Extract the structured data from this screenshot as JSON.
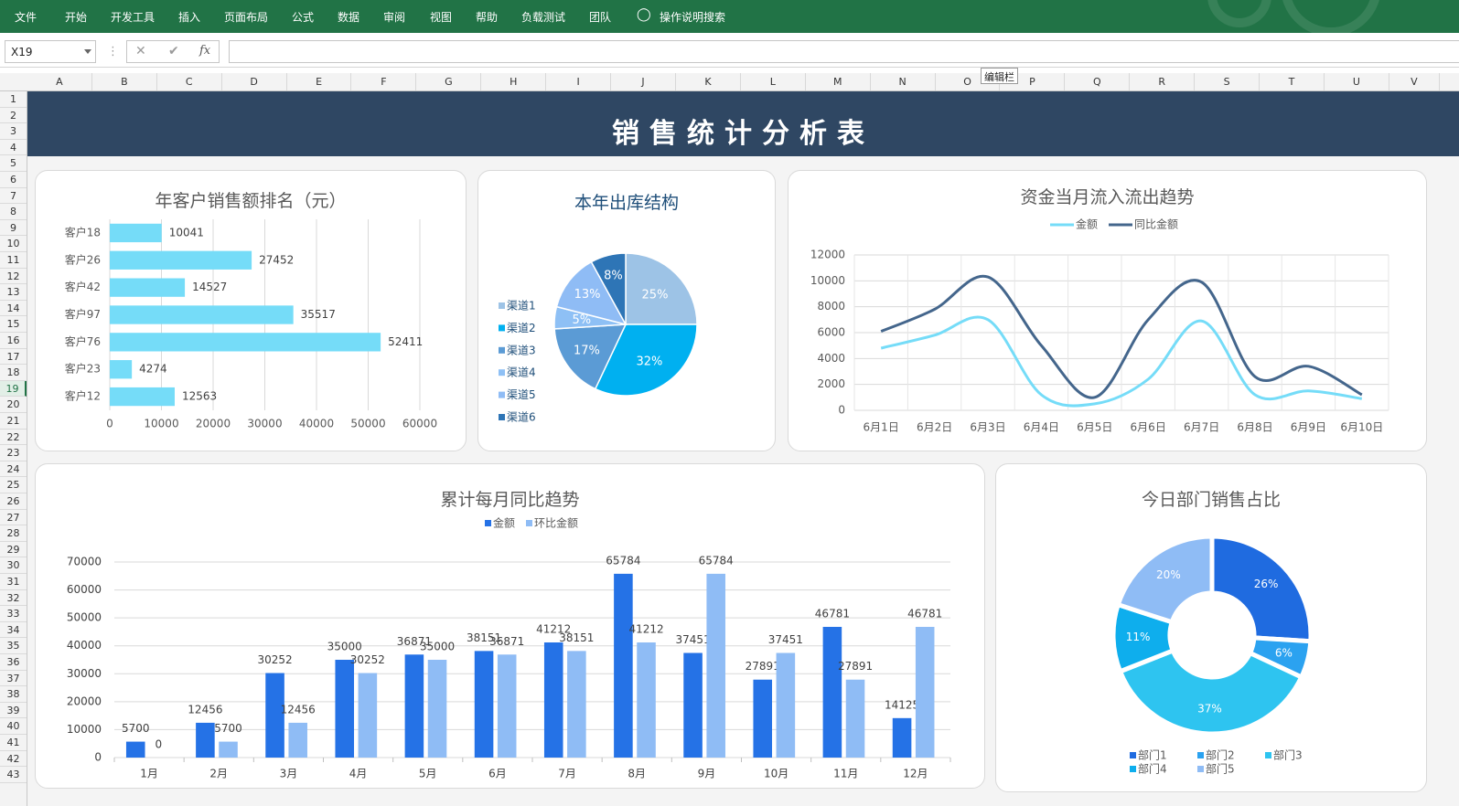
{
  "ribbon": {
    "tabs": [
      "文件",
      "开始",
      "开发工具",
      "插入",
      "页面布局",
      "公式",
      "数据",
      "审阅",
      "视图",
      "帮助",
      "负载测试",
      "团队"
    ],
    "search_label": "操作说明搜索",
    "tab_x": [
      16,
      71,
      121,
      195,
      245,
      319,
      369,
      419,
      470,
      520,
      570,
      644
    ],
    "search_x": 721
  },
  "formula_bar": {
    "name_box": "X19",
    "cancel_icon": "✕",
    "confirm_icon": "✔",
    "fx_label": "fx",
    "formula": "",
    "tooltip": "编辑栏"
  },
  "grid": {
    "columns": [
      "A",
      "B",
      "C",
      "D",
      "E",
      "F",
      "G",
      "H",
      "I",
      "J",
      "K",
      "L",
      "M",
      "N",
      "O",
      "P",
      "Q",
      "R",
      "S",
      "T",
      "U",
      "V"
    ],
    "rows": [
      "1",
      "2",
      "3",
      "4",
      "5",
      "6",
      "7",
      "8",
      "9",
      "10",
      "11",
      "12",
      "13",
      "14",
      "15",
      "16",
      "17",
      "18",
      "19",
      "20",
      "21",
      "22",
      "23",
      "24",
      "25",
      "26",
      "27",
      "28",
      "29",
      "30",
      "31",
      "32",
      "33",
      "34",
      "35",
      "36",
      "37",
      "38",
      "39",
      "40",
      "41",
      "42",
      "43"
    ],
    "selected_row": "19"
  },
  "banner_title": "销售统计分析表",
  "chart_data": [
    {
      "type": "bar",
      "orientation": "horizontal",
      "title": "年客户销售额排名（元）",
      "categories": [
        "客户18",
        "客户26",
        "客户42",
        "客户97",
        "客户76",
        "客户23",
        "客户12"
      ],
      "values": [
        10041,
        27452,
        14527,
        35517,
        52411,
        4274,
        12563
      ],
      "xlim": [
        0,
        60000
      ],
      "xticks": [
        "0",
        "10000",
        "20000",
        "30000",
        "40000",
        "50000",
        "60000"
      ],
      "grid": true,
      "color": "#75dcf8"
    },
    {
      "type": "pie",
      "title": "本年出库结构",
      "legend": [
        "渠道1",
        "渠道2",
        "渠道3",
        "渠道4",
        "渠道5",
        "渠道6"
      ],
      "legend_position": "left",
      "slices": [
        {
          "name": "渠道1",
          "value": 25,
          "label": "25%",
          "color": "#9dc3e6"
        },
        {
          "name": "渠道2",
          "value": 32,
          "label": "32%",
          "color": "#00b0f0"
        },
        {
          "name": "渠道3",
          "value": 17,
          "label": "17%",
          "color": "#5b9bd5"
        },
        {
          "name": "渠道4",
          "value": 5,
          "label": "5%",
          "color": "#8ec0f5"
        },
        {
          "name": "渠道5",
          "value": 13,
          "label": "13%",
          "color": "#8fbcf5"
        },
        {
          "name": "渠道6",
          "value": 8,
          "label": "8%",
          "color": "#2e75b6"
        }
      ]
    },
    {
      "type": "line",
      "title": "资金当月流入流出趋势",
      "categories": [
        "6月1日",
        "6月2日",
        "6月3日",
        "6月4日",
        "6月5日",
        "6月6日",
        "6月7日",
        "6月8日",
        "6月9日",
        "6月10日"
      ],
      "series": [
        {
          "name": "金额",
          "values": [
            4800,
            5800,
            7000,
            1200,
            500,
            2400,
            6900,
            1200,
            1500,
            900
          ],
          "color": "#75dcf8"
        },
        {
          "name": "同比金额",
          "values": [
            6100,
            7800,
            10300,
            5000,
            1000,
            7000,
            9900,
            2600,
            3400,
            1200
          ],
          "color": "#44668c"
        }
      ],
      "ylim": [
        0,
        12000
      ],
      "yticks": [
        "0",
        "2000",
        "4000",
        "6000",
        "8000",
        "10000",
        "12000"
      ],
      "legend_position": "top",
      "grid": true,
      "smooth": true
    },
    {
      "type": "bar",
      "title": "累计每月同比趋势",
      "categories": [
        "1月",
        "2月",
        "3月",
        "4月",
        "5月",
        "6月",
        "7月",
        "8月",
        "9月",
        "10月",
        "11月",
        "12月"
      ],
      "series": [
        {
          "name": "金额",
          "values": [
            5700,
            12456,
            30252,
            35000,
            36871,
            38151,
            41212,
            65784,
            37451,
            27891,
            46781,
            14125
          ],
          "color": "#2572e6"
        },
        {
          "name": "环比金额",
          "values": [
            0,
            5700,
            12456,
            30252,
            35000,
            36871,
            38151,
            41212,
            65784,
            37451,
            27891,
            46781
          ],
          "color": "#8fbcf5"
        }
      ],
      "ylim": [
        0,
        70000
      ],
      "yticks": [
        "0",
        "10000",
        "20000",
        "30000",
        "40000",
        "50000",
        "60000",
        "70000"
      ],
      "legend_position": "top",
      "data_labels": true
    },
    {
      "type": "pie",
      "variant": "doughnut",
      "title": "今日部门销售占比",
      "legend": [
        "部门1",
        "部门2",
        "部门3",
        "部门4",
        "部门5"
      ],
      "legend_position": "bottom",
      "slices": [
        {
          "name": "部门1",
          "value": 26,
          "label": "26%",
          "color": "#1f6be0"
        },
        {
          "name": "部门2",
          "value": 6,
          "label": "6%",
          "color": "#2ba2f0"
        },
        {
          "name": "部门3",
          "value": 37,
          "label": "37%",
          "color": "#2ec4f0"
        },
        {
          "name": "部门4",
          "value": 11,
          "label": "11%",
          "color": "#0eaeed"
        },
        {
          "name": "部门5",
          "value": 20,
          "label": "20%",
          "color": "#8fbcf5"
        }
      ]
    }
  ]
}
